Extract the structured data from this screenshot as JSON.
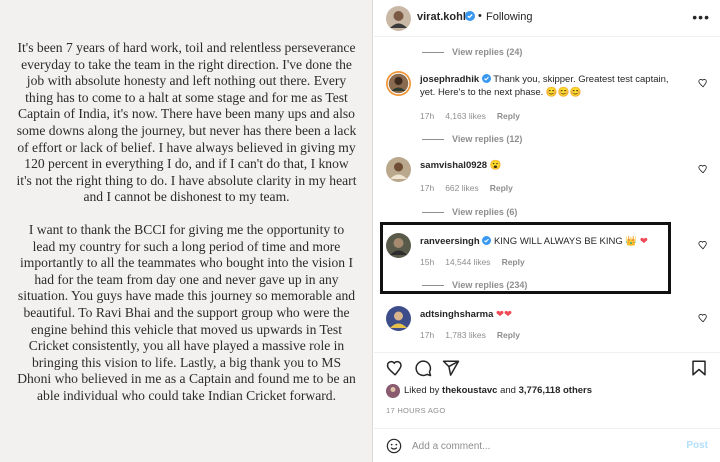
{
  "statement": {
    "paragraph1": "It's been 7 years of hard work, toil and relentless perseverance everyday to take the team in the right direction. I've done the job with absolute honesty and left nothing out there. Every thing has to come to a halt at some stage and for me as Test Captain of India, it's now. There have been many ups and also some downs along the journey, but never has there been a lack of effort or lack of belief. I have always believed in giving my 120 percent in everything I do, and if I can't do that, I know it's not the right thing to do. I have absolute clarity in my heart and I cannot be dishonest to my team.",
    "paragraph2": "I want to thank the BCCI for giving me the opportunity to lead my country for such a long period of time and more importantly to all the teammates who bought into the vision I had for the team from day one and never gave up in any situation. You guys have made this journey so memorable and beautiful. To Ravi Bhai and the support group who were the engine behind this vehicle that moved us upwards in Test Cricket consistently, you all have played a massive role in bringing this vision to life. Lastly, a big thank you to MS Dhoni who believed in me as a Captain and found me to be an able individual who could take Indian Cricket forward."
  },
  "header": {
    "username": "virat.kohli",
    "separator": "•",
    "follow_status": "Following",
    "more": "•••"
  },
  "replies_top": "View replies (24)",
  "comments": [
    {
      "username": "josephradhik",
      "text": "Thank you, skipper. Greatest test captain, yet. Here's to the next phase.",
      "emojis": "😊😊😊",
      "time": "17h",
      "likes": "4,163 likes",
      "reply": "Reply",
      "view_replies": "View replies (12)"
    },
    {
      "username": "samvishal0928",
      "text": "",
      "emojis": "😮",
      "time": "17h",
      "likes": "662 likes",
      "reply": "Reply",
      "view_replies": "View replies (6)"
    },
    {
      "username": "ranveersingh",
      "text": "KING WILL ALWAYS BE KING",
      "emojis": "👑 ❤",
      "time": "15h",
      "likes": "14,544 likes",
      "reply": "Reply",
      "view_replies": "View replies (234)"
    },
    {
      "username": "adtsinghsharma",
      "text": "",
      "emojis": "❤❤",
      "time": "17h",
      "likes": "1,783 likes",
      "reply": "Reply"
    }
  ],
  "liked_by": {
    "prefix": "Liked by",
    "user": "thekoustavc",
    "and": "and",
    "others": "3,776,118 others"
  },
  "time_ago": "17 HOURS AGO",
  "add_comment": {
    "placeholder": "Add a comment...",
    "post": "Post"
  },
  "colors": {
    "verified": "#3897f0",
    "heart_red": "#ed4956",
    "highlight": "#111111"
  },
  "icons": [
    "heart-icon",
    "comment-icon",
    "share-icon",
    "bookmark-icon",
    "emoji-icon",
    "verified-icon",
    "more-icon"
  ]
}
